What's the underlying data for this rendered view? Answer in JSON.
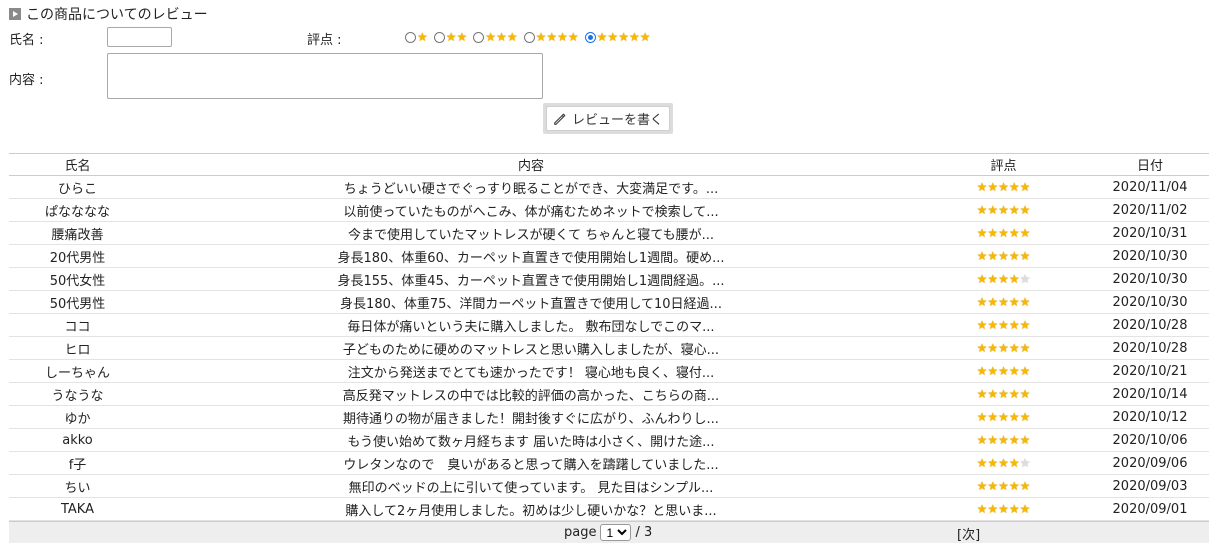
{
  "section_title": "この商品についてのレビュー",
  "form": {
    "name_label": "氏名 :",
    "rating_label": "評点 :",
    "content_label": "内容 :",
    "name_value": "",
    "content_value": "",
    "rating_options": [
      1,
      2,
      3,
      4,
      5
    ],
    "selected_rating": 5,
    "submit_label": "レビューを書く"
  },
  "table": {
    "headers": {
      "name": "氏名",
      "content": "内容",
      "rating": "評点",
      "date": "日付"
    },
    "rows": [
      {
        "name": "ひらこ",
        "content": "ちょうどいい硬さでぐっすり眠ることができ、大変満足です。...",
        "rating": 5,
        "date": "2020/11/04"
      },
      {
        "name": "ぱなななな",
        "content": "以前使っていたものがへこみ、体が痛むためネットで検索して...",
        "rating": 5,
        "date": "2020/11/02"
      },
      {
        "name": "腰痛改善",
        "content": "今まで使用していたマットレスが硬くて ちゃんと寝ても腰が...",
        "rating": 5,
        "date": "2020/10/31"
      },
      {
        "name": "20代男性",
        "content": "身長180、体重60、カーペット直置きで使用開始し1週間。硬め...",
        "rating": 5,
        "date": "2020/10/30"
      },
      {
        "name": "50代女性",
        "content": "身長155、体重45、カーペット直置きで使用開始し1週間経過。...",
        "rating": 4,
        "date": "2020/10/30"
      },
      {
        "name": "50代男性",
        "content": "身長180、体重75、洋間カーペット直置きで使用して10日経過...",
        "rating": 5,
        "date": "2020/10/30"
      },
      {
        "name": "ココ",
        "content": "毎日体が痛いという夫に購入しました。 敷布団なしでこのマ...",
        "rating": 5,
        "date": "2020/10/28"
      },
      {
        "name": "ヒロ",
        "content": "子どものために硬めのマットレスと思い購入しましたが、寝心...",
        "rating": 5,
        "date": "2020/10/28"
      },
      {
        "name": "しーちゃん",
        "content": "注文から発送までとても速かったです！ 寝心地も良く、寝付...",
        "rating": 5,
        "date": "2020/10/21"
      },
      {
        "name": "うなうな",
        "content": "高反発マットレスの中では比較的評価の高かった、こちらの商...",
        "rating": 5,
        "date": "2020/10/14"
      },
      {
        "name": "ゆか",
        "content": "期待通りの物が届きました！開封後すぐに広がり、ふんわりし...",
        "rating": 5,
        "date": "2020/10/12"
      },
      {
        "name": "akko",
        "content": "もう使い始めて数ヶ月経ちます 届いた時は小さく、開けた途...",
        "rating": 5,
        "date": "2020/10/06"
      },
      {
        "name": "f子",
        "content": "ウレタンなので　臭いがあると思って購入を躊躇していました...",
        "rating": 4,
        "date": "2020/09/06"
      },
      {
        "name": "ちい",
        "content": "無印のベッドの上に引いて使っています。 見た目はシンプル...",
        "rating": 5,
        "date": "2020/09/03"
      },
      {
        "name": "TAKA",
        "content": "購入して2ヶ月使用しました。初めは少し硬いかな？と思いま...",
        "rating": 5,
        "date": "2020/09/01"
      }
    ]
  },
  "pager": {
    "prefix": "page",
    "current_page": "1",
    "total_text": "/ 3",
    "next_label": "[次]"
  },
  "colors": {
    "star": "#f6b800",
    "star_empty": "#dddddd",
    "radio_selected": "#1a73e8",
    "pager_bg": "#eeeeee"
  },
  "icons": {
    "title_marker": "chevron-right-box-icon",
    "submit": "pencil-icon",
    "rating": "star-icon"
  }
}
